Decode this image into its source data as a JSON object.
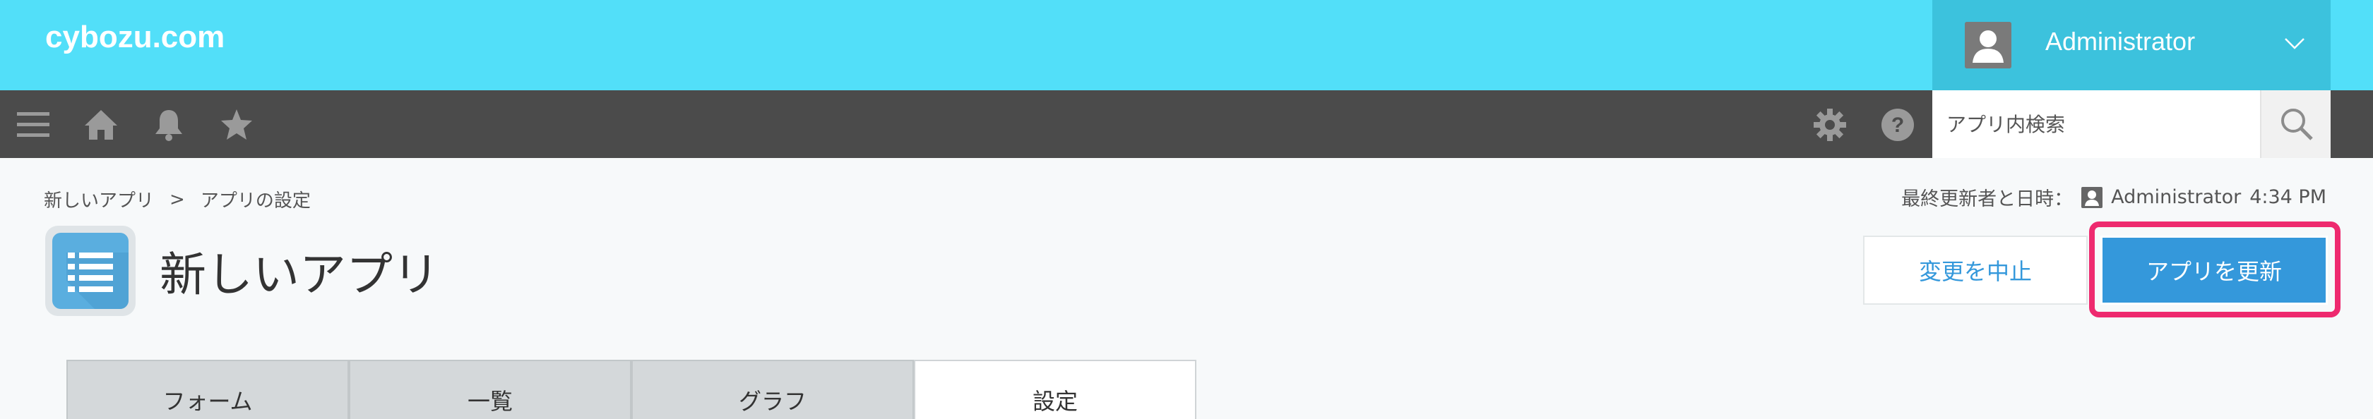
{
  "header": {
    "logo": "cybozu.com",
    "user": {
      "name": "Administrator"
    }
  },
  "toolbar": {
    "icons": [
      "menu-icon",
      "home-icon",
      "bell-icon",
      "star-icon",
      "gear-icon",
      "help-icon"
    ],
    "search": {
      "placeholder": "アプリ内検索",
      "value": ""
    }
  },
  "breadcrumb": {
    "items": [
      "新しいアプリ",
      "アプリの設定"
    ],
    "separator": ">"
  },
  "last_updated": {
    "label": "最終更新者と日時：",
    "user": "Administrator",
    "time": "4:34 PM"
  },
  "app": {
    "title": "新しいアプリ"
  },
  "actions": {
    "cancel_label": "変更を中止",
    "update_label": "アプリを更新"
  },
  "tabs": [
    {
      "label": "フォーム",
      "active": false
    },
    {
      "label": "一覧",
      "active": false
    },
    {
      "label": "グラフ",
      "active": false
    },
    {
      "label": "設定",
      "active": true
    }
  ],
  "colors": {
    "header_bg": "#52dff9",
    "toolbar_bg": "#4b4b4b",
    "accent": "#3498db",
    "highlight": "#ee2a6f"
  }
}
